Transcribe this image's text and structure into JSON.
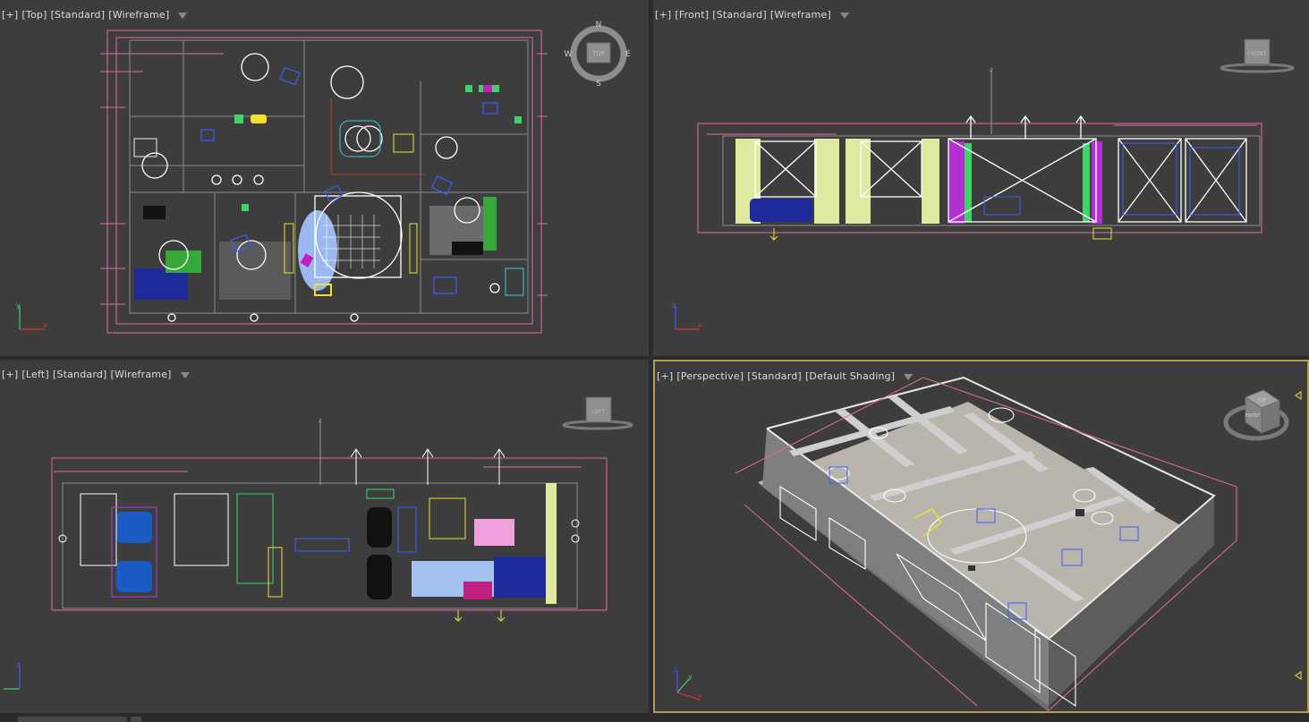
{
  "viewports": {
    "top": {
      "label_parts": [
        "[+]",
        "[Top]",
        "[Standard]",
        "[Wireframe]"
      ],
      "cube_face": "TOP",
      "compass": {
        "n": "N",
        "s": "S",
        "e": "E",
        "w": "W"
      }
    },
    "front": {
      "label_parts": [
        "[+]",
        "[Front]",
        "[Standard]",
        "[Wireframe]"
      ],
      "cube_face": "FRONT"
    },
    "left": {
      "label_parts": [
        "[+]",
        "[Left]",
        "[Standard]",
        "[Wireframe]"
      ],
      "cube_face": "LEFT"
    },
    "perspective": {
      "label_parts": [
        "[+]",
        "[Perspective]",
        "[Standard]",
        "[Default Shading]"
      ],
      "cube_face": "TOP",
      "cube_face2": "FRONT",
      "active": true
    }
  },
  "axes": {
    "x": "x",
    "y": "y",
    "z": "z"
  },
  "colors": {
    "viewport_bg": "#3d3d3d",
    "wire_white": "#ffffff",
    "wire_pink": "#e06aa6",
    "wire_green": "#3fd36a",
    "wire_yellow": "#f0e030",
    "wire_cyan": "#40c8e0",
    "wire_blue": "#3a5cff",
    "wire_purple": "#b040e0",
    "active_border": "#b89a52"
  }
}
